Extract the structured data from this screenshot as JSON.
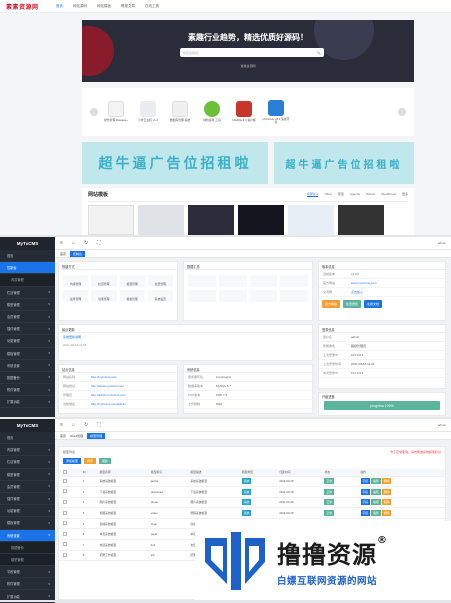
{
  "site": {
    "logo": "素素资源网",
    "nav": [
      "首页",
      "网站源码",
      "网站模板",
      "教程文章",
      "在线工具"
    ],
    "hero_title": "素趣行业趋势，精选优质好源码！",
    "search_placeholder": "搜索关键词...",
    "hero_sub": "素素资源网",
    "apps": [
      {
        "name": "财务管理 Release+",
        "color": "#f3f3f3"
      },
      {
        "name": "小米云主机 v1.2",
        "color": "#e9edf2"
      },
      {
        "name": "数据库管理 系统",
        "color": "#f0f0f0"
      },
      {
        "name": "绿色插件 工具",
        "color": "#6bbf3a"
      },
      {
        "name": "FileZilla 3.4 客户端",
        "color": "#c8362b"
      },
      {
        "name": "phpStudy v8.1 集成环境",
        "color": "#2a7fd4"
      }
    ],
    "ad_text": "超牛逼广告位招租啦",
    "ad_badge": "点击查看",
    "tpl_title": "网站模板",
    "tpl_tabs": [
      "织梦cms",
      "zblog",
      "帝国",
      "typecho",
      "Discuz",
      "WordPress",
      "更多"
    ]
  },
  "admin1": {
    "brand": "MyTxCMS",
    "menu": [
      "首页",
      "控制台",
      "内容管理",
      "栏目管理",
      "模型管理",
      "会员管理",
      "插件管理",
      "功能管理",
      "模板管理",
      "系统设置",
      "数据备份",
      "附件管理",
      "扩展功能"
    ],
    "user": "admin",
    "tabs": [
      "首页",
      "控制台"
    ],
    "quick_title": "快捷方式",
    "quick": [
      "内容管理",
      "栏目管理",
      "模型管理",
      "会员管理",
      "插件管理",
      "功能管理",
      "模板管理",
      "系统设置"
    ],
    "data_title": "数据汇总",
    "version_title": "版本信息",
    "version_rows": [
      {
        "k": "当前版本",
        "v": "v1.2.0"
      },
      {
        "k": "官方网站",
        "v": "www.mytxcms.com"
      },
      {
        "k": "交流群",
        "v": "点击加入"
      }
    ],
    "btns": [
      "官方网站",
      "检查更新",
      "在线文档"
    ],
    "latest_title": "最近更新",
    "latest": "系统更新说明",
    "latest_date": "2021-09-18 11:05",
    "site_title": "站点信息",
    "site_rows": [
      {
        "k": "网站名称",
        "v": "http://mytxcms.com"
      },
      {
        "k": "网站地址",
        "v": "http://www.mytxcms.com"
      },
      {
        "k": "管理员",
        "v": "http://admin.mytxcms.com"
      },
      {
        "k": "当前域名",
        "v": "http://mytxcms.com/admin"
      }
    ],
    "env_title": "系统信息",
    "env_rows": [
      {
        "k": "服务器环境",
        "v": "Linux/nginx"
      },
      {
        "k": "数据库版本",
        "v": "MySQL 5.7"
      },
      {
        "k": "PHP版本",
        "v": "PHP 7.4"
      },
      {
        "k": "上传限制",
        "v": "50M"
      }
    ],
    "login_title": "登录信息",
    "login_rows": [
      {
        "k": "用户名",
        "v": "admin"
      },
      {
        "k": "所属角色",
        "v": "超级管理员"
      },
      {
        "k": "上次登录IP",
        "v": "127.0.0.1"
      },
      {
        "k": "上次登录时间",
        "v": "2021-09-18 11:02"
      },
      {
        "k": "本次登录IP",
        "v": "127.0.0.1"
      }
    ],
    "progress_title": "升级进度",
    "progress_label": "progress 100%",
    "progress_value": 1.0
  },
  "admin2": {
    "brand": "MyTxCMS",
    "menu": [
      "首页",
      "内容管理",
      "栏目管理",
      "模型管理",
      "会员管理",
      "插件管理",
      "功能管理",
      "模板管理",
      "系统设置",
      "数据备份",
      "模型管理",
      "字段管理",
      "附件管理",
      "扩展功能"
    ],
    "user": "admin",
    "tabs": [
      "首页",
      "Word管理",
      "模型管理"
    ],
    "crumb": "模型列表",
    "warn": "为了正常使用，请勿修改系统模型标识",
    "tools": [
      "添加模型",
      "排序",
      "刷新"
    ],
    "columns": [
      "",
      "ID",
      "模型名称",
      "模型标识",
      "模型描述",
      "模型类型",
      "创建时间",
      "状态",
      "操作"
    ],
    "rows": [
      {
        "id": "1",
        "name": "系统基础模型",
        "ident": "article",
        "desc": "系统基础模型",
        "type": "系统",
        "time": "2021-09-18",
        "st": "正常"
      },
      {
        "id": "2",
        "name": "下载系统模型",
        "ident": "download",
        "desc": "下载系统模型",
        "type": "系统",
        "time": "2021-09-18",
        "st": "正常"
      },
      {
        "id": "3",
        "name": "图片系统模型",
        "ident": "photo",
        "desc": "图片系统模型",
        "type": "系统",
        "time": "2021-09-18",
        "st": "正常"
      },
      {
        "id": "4",
        "name": "视频系统模型",
        "ident": "video",
        "desc": "视频系统模型",
        "type": "系统",
        "time": "2021-09-18",
        "st": "正常"
      },
      {
        "id": "5",
        "name": "商城系统模型",
        "ident": "shop",
        "desc": "商城系统模型",
        "type": "系统",
        "time": "2021-09-18",
        "st": "正常"
      },
      {
        "id": "6",
        "name": "单页系统模型",
        "ident": "page",
        "desc": "单页系统模型",
        "type": "系统",
        "time": "2021-09-18",
        "st": "正常"
      },
      {
        "id": "7",
        "name": "友链系统模型",
        "ident": "link",
        "desc": "友链系统模型",
        "type": "系统",
        "time": "2021-09-18",
        "st": "正常"
      },
      {
        "id": "8",
        "name": "招聘工作模型",
        "ident": "job",
        "desc": "招聘工作模型",
        "type": "系统",
        "time": "2021-09-18",
        "st": "正常"
      }
    ],
    "ops": [
      "字段",
      "编辑",
      "删除"
    ]
  },
  "watermark": {
    "title": "撸撸资源",
    "reg": "®",
    "sub": "白嫖互联网资源的网站"
  },
  "colors": {
    "primary": "#1a73e8",
    "sidebar": "#262c35",
    "green": "#5bb49b",
    "orange": "#f0a030",
    "red": "#e33"
  }
}
